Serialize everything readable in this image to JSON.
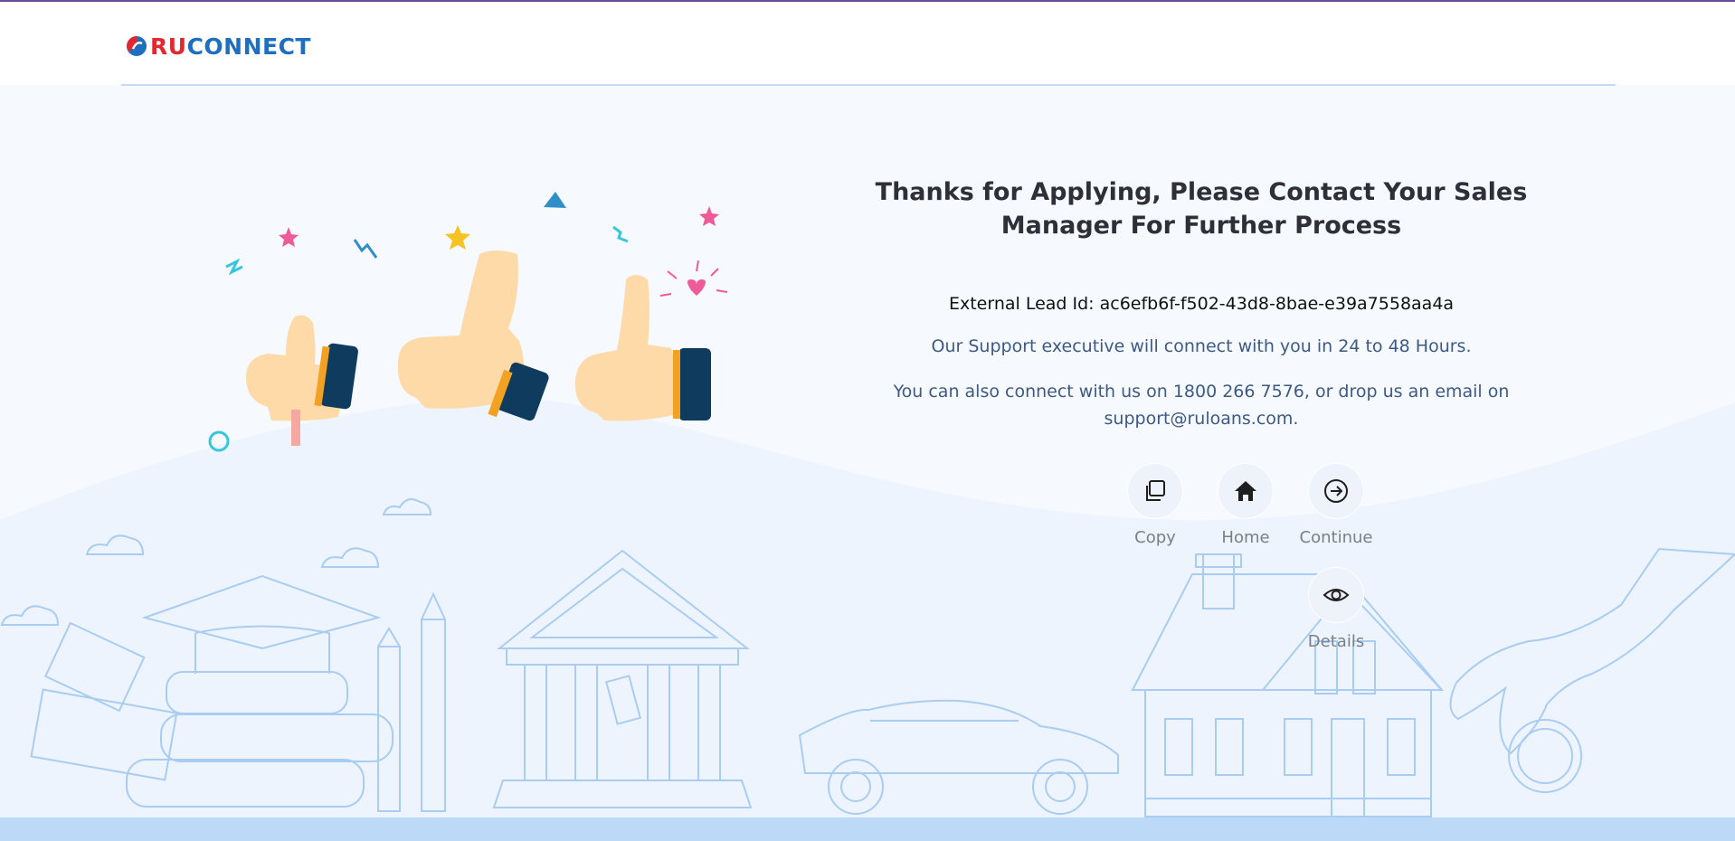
{
  "brand": {
    "ru": "RU",
    "connect": "CONNECT",
    "red": "#e3262f",
    "blue": "#1f6fc0"
  },
  "main": {
    "title": "Thanks for Applying, Please Contact Your Sales Manager For Further Process",
    "lead_label": "External Lead Id: ",
    "lead_id": "ac6efb6f-f502-43d8-8bae-e39a7558aa4a",
    "support_text": "Our Support executive will connect with you in 24 to 48 Hours.",
    "contact_text": "You can also connect with us on 1800 266 7576, or drop us an email on support@ruloans.com."
  },
  "actions": [
    {
      "label": "Copy",
      "icon": "copy-icon"
    },
    {
      "label": "Home",
      "icon": "home-icon"
    },
    {
      "label": "Continue",
      "icon": "arrow-right-circle-icon"
    },
    {
      "label": "Details",
      "icon": "eye-icon"
    }
  ],
  "colors": {
    "accent_text": "#3d5a85",
    "band": "#bcdaf8",
    "line_art": "#a9cdf2"
  }
}
